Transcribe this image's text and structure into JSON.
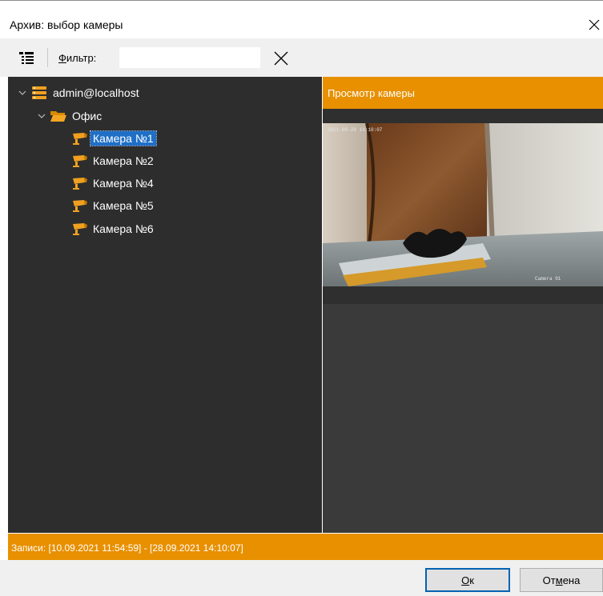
{
  "window": {
    "title": "Архив: выбор камеры"
  },
  "toolbar": {
    "filter_label_accel": "Ф",
    "filter_label_rest": "ильтр:",
    "filter_value": "",
    "filter_placeholder": ""
  },
  "tree": {
    "server": "admin@localhost",
    "folder": "Офис",
    "cameras": [
      "Камера №1",
      "Камера №2",
      "Камера №4",
      "Камера №5",
      "Камера №6"
    ],
    "selected_camera": "Камера №1"
  },
  "preview": {
    "title": "Просмотр камеры",
    "osd_caption": "Camera 01",
    "osd_timestamp": "2021-09-28 14:10:07"
  },
  "status": {
    "records": "Записи: [10.09.2021 11:54:59] - [28.09.2021 14:10:07]"
  },
  "buttons": {
    "ok_accel": "О",
    "ok_rest": "к",
    "cancel_prefix": "От",
    "cancel_accel": "м",
    "cancel_rest": "ена"
  },
  "colors": {
    "accent": "#e89000",
    "selection": "#1f6fc7",
    "panel": "#2d2d2d"
  }
}
